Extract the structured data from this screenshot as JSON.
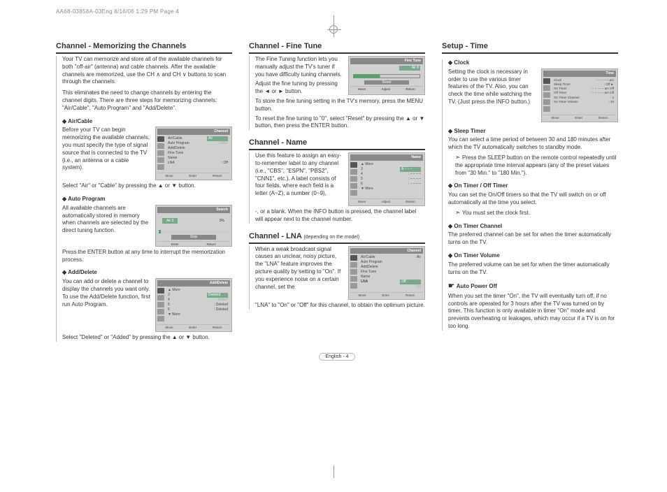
{
  "print_header": "AA68-03858A-03Eng  8/16/06  1:29 PM  Page 4",
  "page_footer": "English - 4",
  "col1": {
    "s1": {
      "title": "Channel - Memorizing the Channels",
      "intro": "Your TV can memorize and store all of the available channels for both \"off-air\" (antenna) and cable channels. After the available channels are memorized, use the CH ∧ and CH ∨ buttons to scan through the channels.",
      "intro2": "This eliminates the need to change channels by entering the channel digits. There are three steps for memorizing channels: \"Air/Cable\", \"Auto Program\" and \"Add/Delete\".",
      "h1": "Air/Cable",
      "p1a": "Before your TV can begin memorizing the available channels, you must specify the type of signal source that is connected to the TV (i.e., an antenna or a cable system).",
      "p1b": "Select \"Air\" or \"Cable\" by pressing the ▲ or ▼ button.",
      "h2": "Auto Program",
      "p2a": "All available channels are automatically stored in memory when channels are selected by the direct tuning function.",
      "p2b": "Press the ENTER button at any time to interrupt the memorization process.",
      "h3": "Add/Delete",
      "p3a": "You can add or delete a channel to display the channels you want only. To use the Add/Delete function, first run Auto Program.",
      "p3b": "Select \"Deleted\" or \"Added\" by pressing the ▲ or ▼ button."
    },
    "osd_channel": {
      "title": "Channel",
      "items": [
        "Air/Cable",
        "Auto Program",
        "Add/Delete",
        "Fine Tune",
        "Name",
        "LNA"
      ],
      "lna_val": ": Off",
      "hl": "Air",
      "hl2": "Cable",
      "f1": "Move",
      "f2": "Enter",
      "f3": "Return"
    },
    "osd_search": {
      "title": "Search",
      "ch": "Air 3",
      "pct": "3%",
      "stop": "Stop",
      "f1": "Enter",
      "f2": "Return"
    },
    "osd_add": {
      "title": "Add/Delete",
      "more_up": "▲ More",
      "more_dn": "▼ More",
      "rows": [
        "3",
        "4",
        "5",
        "6"
      ],
      "status": [
        "Deleted",
        ": Added",
        ": Deleted",
        ": Deleted",
        ": Deleted"
      ],
      "f1": "Move",
      "f2": "Enter",
      "f3": "Return"
    }
  },
  "col2": {
    "s1": {
      "title": "Channel - Fine Tune",
      "p1": "The Fine Tuning function lets you manually adjust the TV's tuner if you have difficulty tuning channels.",
      "p2": "Adjust the fine tuning by pressing the ◄ or ► button.",
      "p3": "To store the fine tuning setting in the TV's memory, press the MENU button.",
      "p4": "To reset the fine tuning to \"0\", select \"Reset\" by pressing the ▲ or ▼ button, then press the ENTER button."
    },
    "osd_ft": {
      "title": "Fine Tune",
      "ch": "Air 8",
      "reset": "Reset",
      "f1": "Move",
      "f2": "Adjust",
      "f3": "Return"
    },
    "s2": {
      "title": "Channel - Name",
      "p1": "Use this feature to assign an easy-to-remember label to any channel (i.e., \"CBS\", \"ESPN\", \"PBS2\", \"CNN1\", etc.). A label consists of four fields, where each field is a letter (A~Z), a number (0~9),",
      "p2": "-, or a blank. When the INFO button is pressed, the channel label will appear next to the channel number."
    },
    "osd_name": {
      "title": "Name",
      "more_up": "▲ More",
      "more_dn": "▼ More",
      "rows": [
        "3",
        "4",
        "5",
        "6"
      ],
      "val": "A – – –",
      "dash": ": – – – –",
      "f1": "Move",
      "f2": "Adjust",
      "f3": "Return"
    },
    "s3": {
      "title": "Channel - LNA",
      "dep": "(depending on the model)",
      "p1": "When a weak broadcast signal causes an unclear, noisy picture, the \"LNA\" feature improves the picture quality by setting to \"On\". If you experience noise on a certain channel, set the",
      "p2": "\"LNA\" to \"On\" or \"Off\" for this channel, to obtain the optimum picture."
    },
    "osd_lna": {
      "title": "Channel",
      "items": [
        "Air/Cable",
        "Auto Program",
        "Add/Delete",
        "Fine Tune",
        "Name",
        "LNA"
      ],
      "air": ": Air",
      "off": "Off",
      "on": "On",
      "f1": "Move",
      "f2": "Enter",
      "f3": "Return"
    }
  },
  "col3": {
    "s1": {
      "title": "Setup - Time",
      "h1": "Clock",
      "p1": "Setting the clock is necessary in order to use the various timer features of the TV. Also, you can check the time while watching the TV. (Just press the INFO button.)",
      "h2": "Sleep Timer",
      "p2": "You can select a time period of between 30 and 180 minutes after which the TV automatically switches to standby mode.",
      "p2a": "Press the SLEEP button on the remote control repeatedly until the appropriate time interval appears (any of the preset values from \"30 Min.\" to  \"180 Min.\").",
      "h3": "On Timer / Off Timer",
      "p3": "You can set the On/Off timers so that the TV will switch on or off automatically at the time you select.",
      "p3a": "You must set the clock first.",
      "h4": "On Timer Channel",
      "p4": "The preferred channel can be set for when the timer automatically turns on the TV.",
      "h5": "On Timer Volume",
      "p5": "The preferred volume can be set for when the timer automatically turns on the TV.",
      "h6": "Auto Power Off",
      "p6": "When you set the timer \"On\", the TV will eventually turn off, if no controls are operated for 3 hours after the TV was turned on by timer. This function is only available in timer \"On\" mode and prevents overheating or leakages, which may occur if a TV is on for too long."
    },
    "osd_time": {
      "title": "Time",
      "r1": "Clock",
      "v1": ": – – : – –  am",
      "r2": "Sleep Timer",
      "v2": ": Off        ►",
      "r3": "On Timer",
      "v3": ": – – : – –  am Off",
      "r4": "Off Timer",
      "v4": ": – – : – –  am Off",
      "r5": "On Timer Channel",
      "v5": ": 3",
      "r6": "On Timer Volume",
      "v6": ": 10",
      "f1": "Move",
      "f2": "Enter",
      "f3": "Return"
    }
  }
}
